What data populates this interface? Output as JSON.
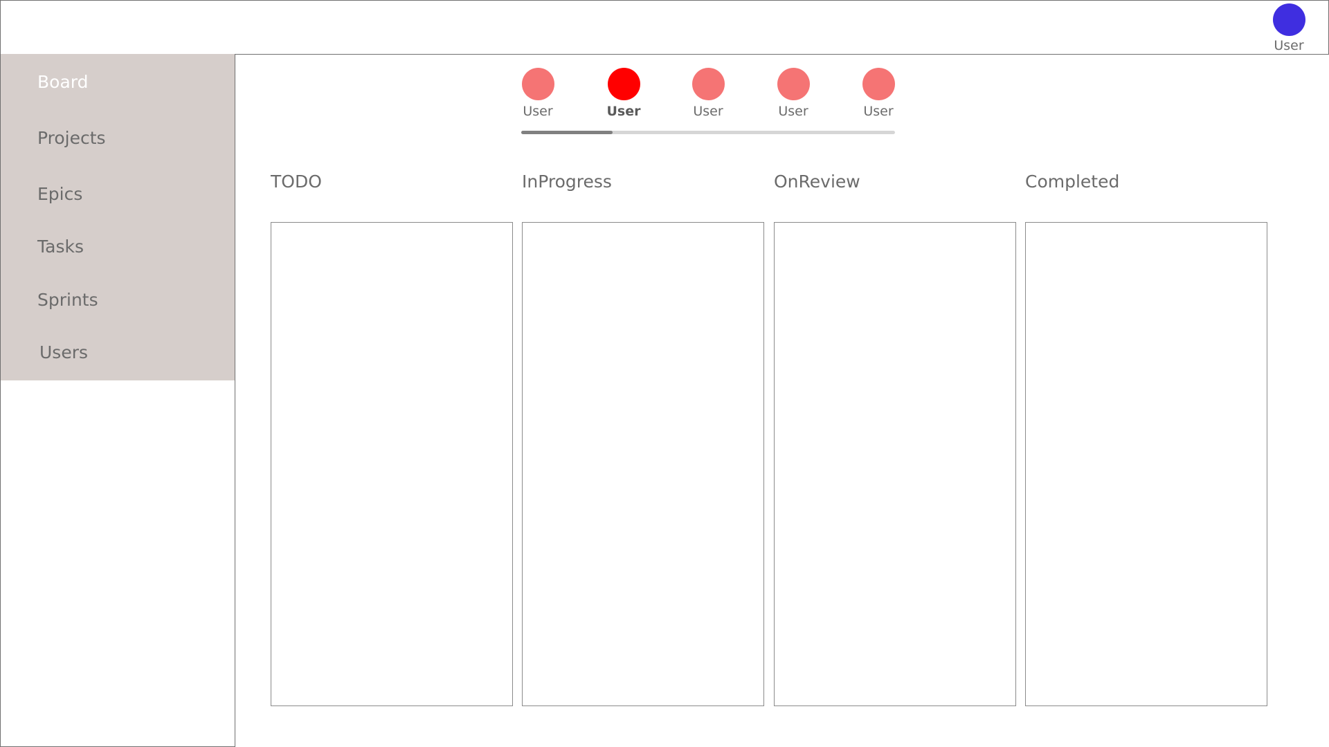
{
  "header": {
    "user_label": "User",
    "avatar_color": "#3f2ee0"
  },
  "sidebar": {
    "background_color": "#d6cecb",
    "items": [
      {
        "label": "Board",
        "active": true
      },
      {
        "label": "Projects",
        "active": false
      },
      {
        "label": "Epics",
        "active": false
      },
      {
        "label": "Tasks",
        "active": false
      },
      {
        "label": "Sprints",
        "active": false
      },
      {
        "label": "Users",
        "active": false
      }
    ]
  },
  "stepper": {
    "progress_fraction": 0.245,
    "inactive_color": "#f57474",
    "active_color": "#ff0000",
    "steps": [
      {
        "label": "User",
        "active": false
      },
      {
        "label": "User",
        "active": true
      },
      {
        "label": "User",
        "active": false
      },
      {
        "label": "User",
        "active": false
      },
      {
        "label": "User",
        "active": false
      }
    ]
  },
  "board": {
    "columns": [
      {
        "title": "TODO"
      },
      {
        "title": "InProgress"
      },
      {
        "title": "OnReview"
      },
      {
        "title": "Completed"
      }
    ]
  }
}
